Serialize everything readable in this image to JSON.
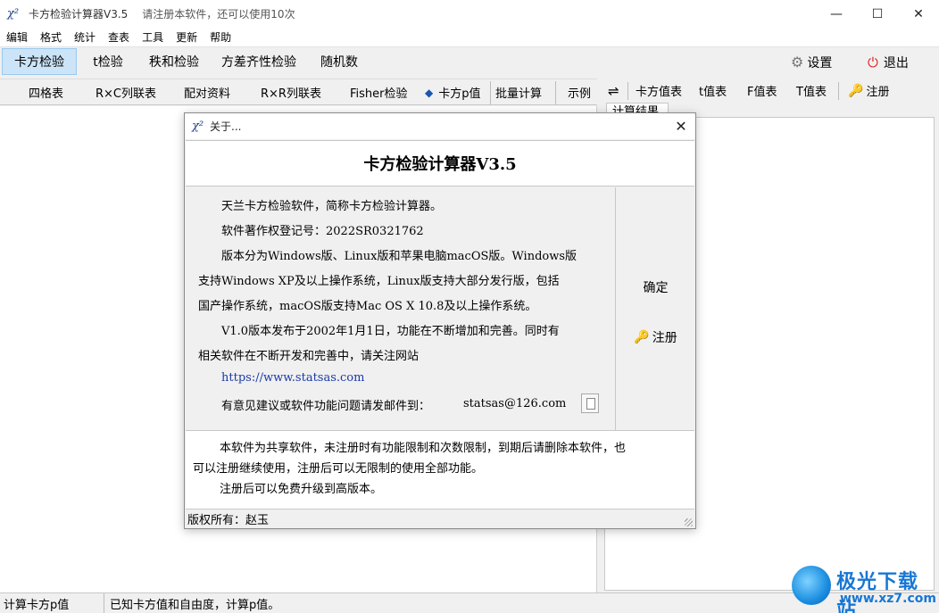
{
  "window": {
    "icon": "χ²",
    "title": "卡方检验计算器V3.5",
    "register_hint": "请注册本软件，还可以使用10次",
    "controls": {
      "minimize": "—",
      "maximize": "☐",
      "close": "✕"
    }
  },
  "menubar": [
    "编辑",
    "格式",
    "统计",
    "查表",
    "工具",
    "更新",
    "帮助"
  ],
  "main_tabs": [
    "卡方检验",
    "t检验",
    "秩和检验",
    "方差齐性检验",
    "随机数"
  ],
  "main_tabs_active": "卡方检验",
  "main_right": {
    "settings": "设置",
    "exit": "退出"
  },
  "sub_tabs": [
    "四格表",
    "R×C列联表",
    "配对资料",
    "R×R列联表",
    "Fisher检验",
    "卡方p值",
    "批量计算",
    "示例"
  ],
  "sub_tabs_active": "卡方p值",
  "right_toolbar": {
    "swap": "⇌",
    "items": [
      "卡方值表",
      "t值表",
      "F值表",
      "T值表"
    ],
    "register": "注册"
  },
  "right_tab": "计算结果",
  "statusbar": {
    "left": "计算卡方p值",
    "right": "已知卡方值和自由度，计算p值。"
  },
  "watermark": {
    "line1": "极光下载站",
    "line2": "www.xz7.com"
  },
  "dialog": {
    "icon": "χ²",
    "caption": "关于...",
    "close": "✕",
    "heading": "卡方检验计算器V3.5",
    "lines": [
      "天兰卡方检验软件，简称卡方检验计算器。",
      "软件著作权登记号：2022SR0321762",
      "版本分为Windows版、Linux版和苹果电脑macOS版。Windows版",
      "支持Windows XP及以上操作系统，Linux版支持大部分发行版，包括",
      "国产操作系统，macOS版支持Mac OS X 10.8及以上操作系统。",
      "V1.0版本发布于2002年1月1日，功能在不断增加和完善。同时有",
      "相关软件在不断开发和完善中，请关注网站"
    ],
    "website": "https://www.statsas.com",
    "email_prompt": "有意见建议或软件功能问题请发邮件到：",
    "email": "statsas@126.com",
    "ok_button": "确定",
    "register_button": "注册",
    "notice": [
      "本软件为共享软件，未注册时有功能限制和次数限制，到期后请删除本软件，也",
      "可以注册继续使用，注册后可以无限制的使用全部功能。",
      "注册后可以免费升级到高版本。"
    ],
    "copyright": "版权所有：赵玉"
  }
}
